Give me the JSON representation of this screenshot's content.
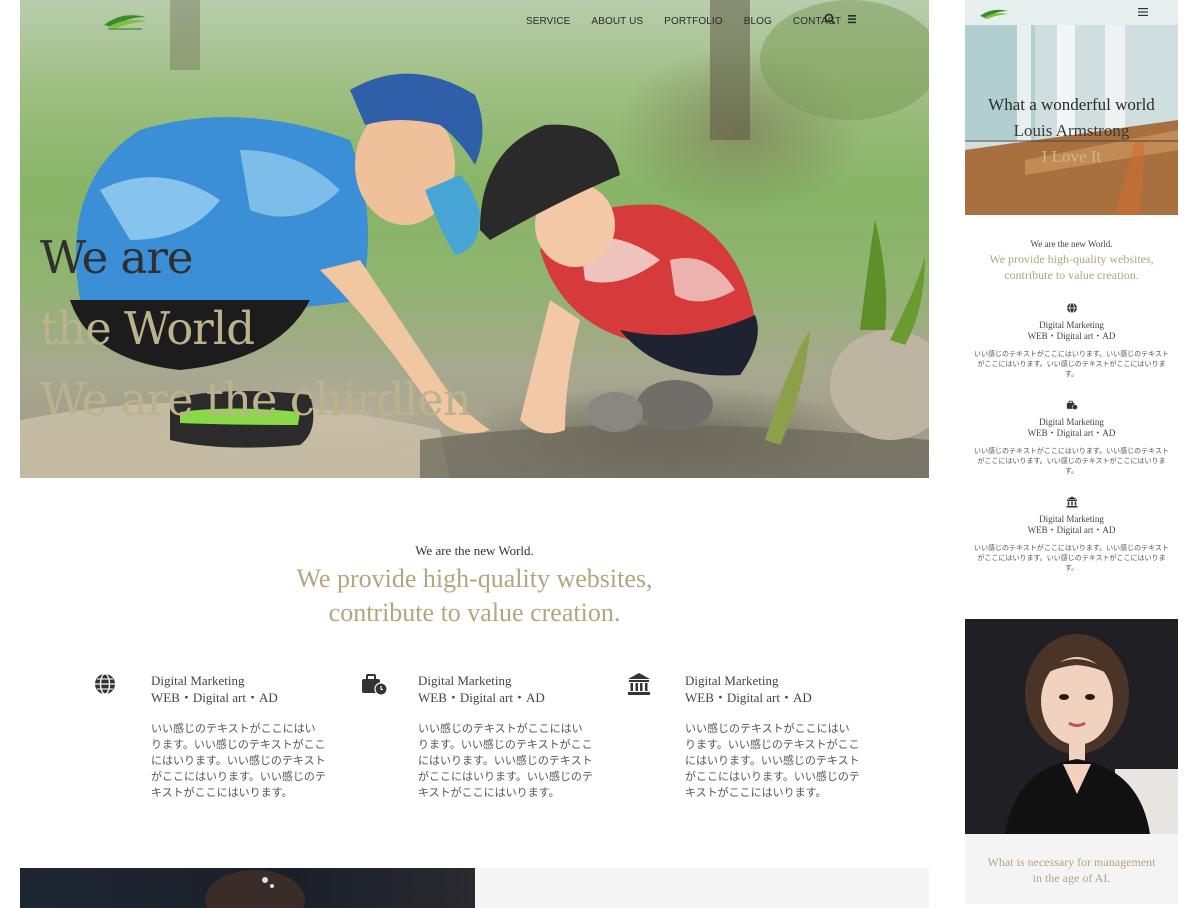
{
  "nav": {
    "items": [
      "SERVICE",
      "ABOUT US",
      "PORTFOLIO",
      "BLOG",
      "CONTACT"
    ],
    "icons": [
      "search-icon",
      "menu-icon"
    ]
  },
  "hero": {
    "line1": "We are",
    "line2": "the World",
    "line3": "We are the chirdlen"
  },
  "intro": {
    "small": "We are the new World.",
    "big_line1": "We provide high-quality websites,",
    "big_line2": "contribute to value creation."
  },
  "services": [
    {
      "icon": "globe-icon",
      "title": "Digital Marketing",
      "subtitle": "WEB・Digital art・AD",
      "desc": "いい感じのテキストがここにはいります。いい感じのテキストがここにはいります。いい感じのテキストがここにはいります。いい感じのテキストがここにはいります。"
    },
    {
      "icon": "briefcase-clock-icon",
      "title": "Digital Marketing",
      "subtitle": "WEB・Digital art・AD",
      "desc": "いい感じのテキストがここにはいります。いい感じのテキストがここにはいります。いい感じのテキストがここにはいります。いい感じのテキストがここにはいります。"
    },
    {
      "icon": "bank-icon",
      "title": "Digital Marketing",
      "subtitle": "WEB・Digital art・AD",
      "desc": "いい感じのテキストがここにはいります。いい感じのテキストがここにはいります。いい感じのテキストがここにはいります。いい感じのテキストがここにはいります。"
    }
  ],
  "sidebar": {
    "hero": {
      "line1": "What a wonderful world",
      "line2": "Louis Armstrong",
      "line3": "I Love It"
    },
    "intro_small": "We are the new World.",
    "intro_big_line1": "We provide high-quality websites,",
    "intro_big_line2": "contribute to value creation.",
    "services": [
      {
        "icon": "globe-icon",
        "title": "Digital Marketing",
        "subtitle": "WEB・Digital art・AD",
        "desc": "いい感じのテキストがここにはいります。いい感じのテキストがここにはいります。いい感じのテキストがここにはいります。"
      },
      {
        "icon": "briefcase-clock-icon",
        "title": "Digital Marketing",
        "subtitle": "WEB・Digital art・AD",
        "desc": "いい感じのテキストがここにはいります。いい感じのテキストがここにはいります。いい感じのテキストがここにはいります。"
      },
      {
        "icon": "bank-icon",
        "title": "Digital Marketing",
        "subtitle": "WEB・Digital art・AD",
        "desc": "いい感じのテキストがここにはいります。いい感じのテキストがここにはいります。いい感じのテキストがここにはいります。"
      }
    ],
    "caption_line1": "What is necessary for management",
    "caption_line2": "in the age of AI."
  },
  "colors": {
    "accent": "#b5a57e",
    "text": "#333333"
  }
}
